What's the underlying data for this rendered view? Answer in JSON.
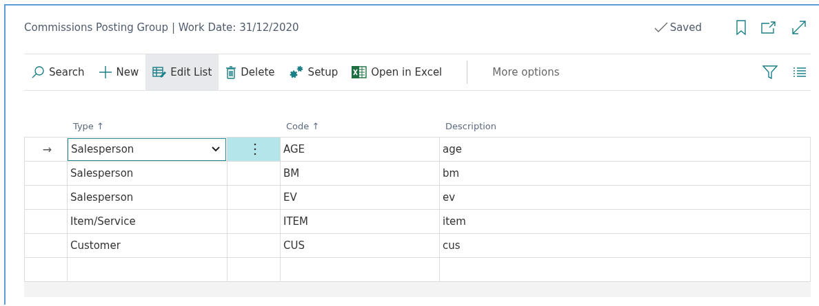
{
  "header": {
    "title": "Commissions Posting Group | Work Date: 31/12/2020",
    "status": "Saved"
  },
  "actions": [
    {
      "kind": "search",
      "label": "Search",
      "selected": false
    },
    {
      "kind": "new",
      "label": "New",
      "selected": false
    },
    {
      "kind": "edit",
      "label": "Edit List",
      "selected": true
    },
    {
      "kind": "delete",
      "label": "Delete",
      "selected": false
    },
    {
      "kind": "setup",
      "label": "Setup",
      "selected": false
    },
    {
      "kind": "excel",
      "label": "Open in Excel",
      "selected": false
    }
  ],
  "more_options": "More options",
  "table": {
    "columns": [
      {
        "label": "Type",
        "sort": "↑"
      },
      {
        "label": "Code",
        "sort": "↑"
      },
      {
        "label": "Description"
      }
    ],
    "rows": [
      {
        "indicator": "→",
        "type": "Salesperson",
        "code": "AGE",
        "description": "age"
      },
      {
        "type": "Salesperson",
        "code": "BM",
        "description": "bm"
      },
      {
        "type": "Salesperson",
        "code": "EV",
        "description": "ev"
      },
      {
        "type": "Item/Service",
        "code": "ITEM",
        "description": "item"
      },
      {
        "type": "Customer",
        "code": "CUS",
        "description": "cus"
      }
    ]
  }
}
